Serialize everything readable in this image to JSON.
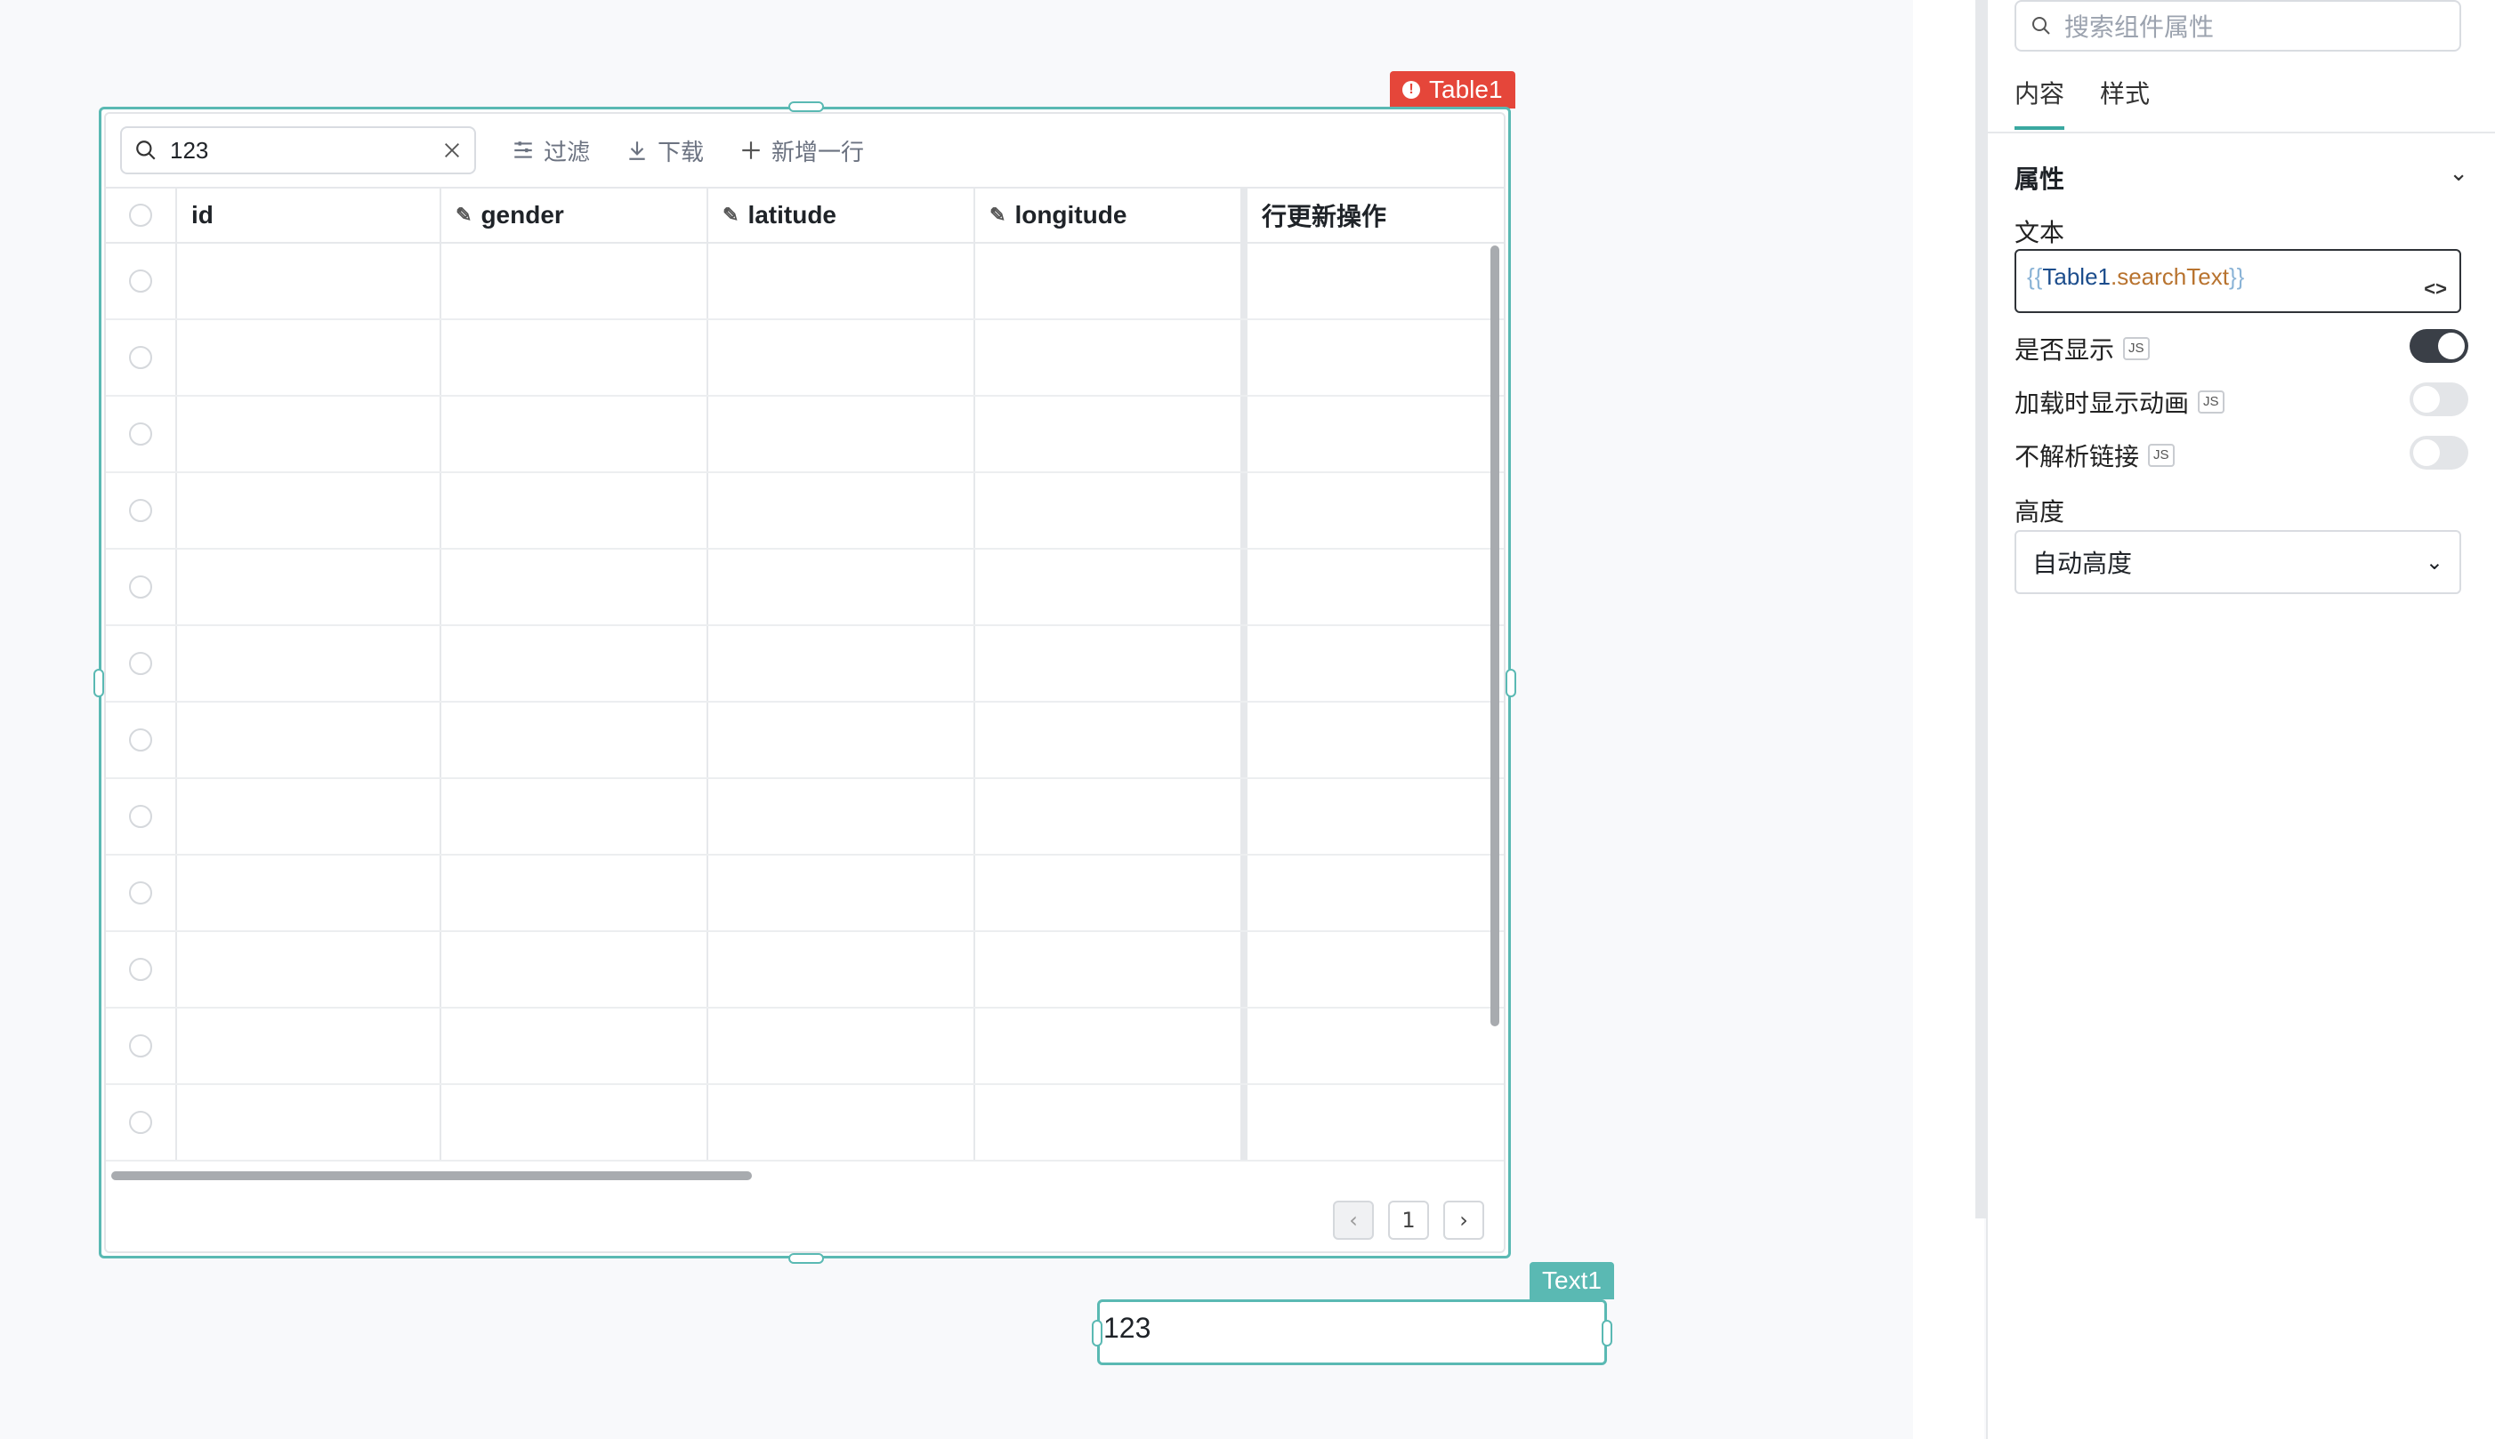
{
  "table": {
    "tag_label": "Table1",
    "search_value": "123",
    "toolbar": {
      "filter": "过滤",
      "download": "下载",
      "add_row": "新增一行"
    },
    "columns": [
      "id",
      "gender",
      "latitude",
      "longitude",
      "行更新操作"
    ],
    "row_count": 12,
    "page": "1"
  },
  "text1": {
    "tag_label": "Text1",
    "value": "123"
  },
  "panel": {
    "search_placeholder": "搜索组件属性",
    "tabs": [
      "内容",
      "样式"
    ],
    "section_title": "属性",
    "text_label": "文本",
    "code": {
      "open": "{{",
      "ref": "Table1",
      "prop": ".searchText",
      "close": "}}"
    },
    "js_badge": "JS",
    "visible_label": "是否显示",
    "visible_on": true,
    "loading_anim_label": "加载时显示动画",
    "loading_anim_on": false,
    "no_parse_links_label": "不解析链接",
    "no_parse_links_on": false,
    "height_label": "高度",
    "height_value": "自动高度"
  },
  "colors": {
    "accent": "#5ab9b3",
    "error": "#e5463a",
    "toggle_on": "#3a3f47"
  }
}
